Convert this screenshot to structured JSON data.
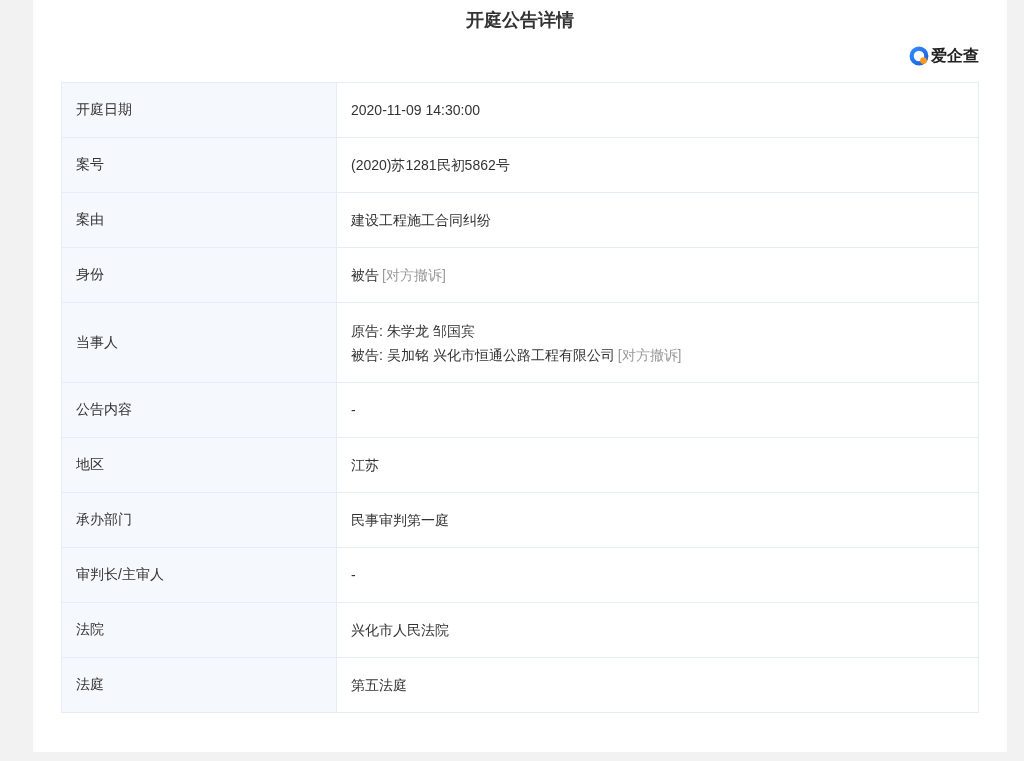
{
  "title": "开庭公告详情",
  "brand": {
    "name": "爱企查"
  },
  "table": {
    "rows": [
      {
        "label": "开庭日期",
        "lines": [
          {
            "text": "2020-11-09 14:30:00"
          }
        ]
      },
      {
        "label": "案号",
        "lines": [
          {
            "text": "(2020)苏1281民初5862号"
          }
        ]
      },
      {
        "label": "案由",
        "lines": [
          {
            "text": "建设工程施工合同纠纷"
          }
        ]
      },
      {
        "label": "身份",
        "lines": [
          {
            "text": "被告",
            "note": "[对方撤诉]"
          }
        ]
      },
      {
        "label": "当事人",
        "lines": [
          {
            "text": "原告: 朱学龙 邹国宾"
          },
          {
            "text": "被告: 吴加铭 兴化市恒通公路工程有限公司",
            "note": "[对方撤诉]"
          }
        ]
      },
      {
        "label": "公告内容",
        "lines": [
          {
            "text": "-"
          }
        ]
      },
      {
        "label": "地区",
        "lines": [
          {
            "text": "江苏"
          }
        ]
      },
      {
        "label": "承办部门",
        "lines": [
          {
            "text": "民事审判第一庭"
          }
        ]
      },
      {
        "label": "审判长/主审人",
        "lines": [
          {
            "text": "-"
          }
        ]
      },
      {
        "label": "法院",
        "lines": [
          {
            "text": "兴化市人民法院"
          }
        ]
      },
      {
        "label": "法庭",
        "lines": [
          {
            "text": "第五法庭"
          }
        ]
      }
    ]
  }
}
